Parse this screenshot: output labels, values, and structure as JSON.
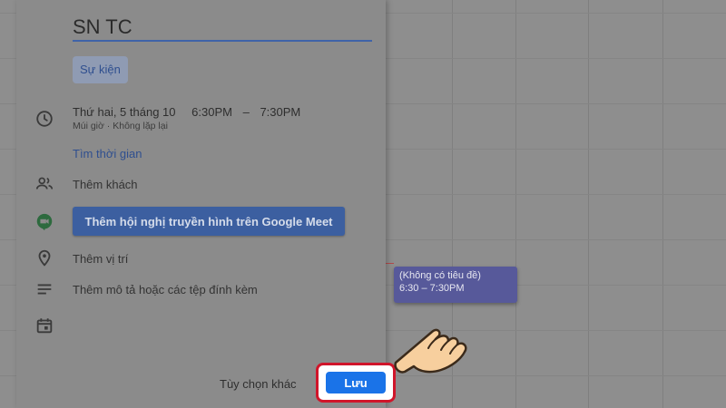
{
  "dialog": {
    "title_value": "SN TC",
    "tab_event": "Sự kiện",
    "date": "Thứ hai, 5 tháng 10",
    "start_time": "6:30PM",
    "separator": "–",
    "end_time": "7:30PM",
    "timezone_repeat": "Múi giờ · Không lặp lại",
    "find_time": "Tìm thời gian",
    "add_guests": "Thêm khách",
    "add_meet": "Thêm hội nghị truyền hình trên Google Meet",
    "add_location": "Thêm vị trí",
    "add_description": "Thêm mô tả hoặc các tệp đính kèm",
    "more_options": "Tùy chọn khác",
    "save": "Lưu"
  },
  "calendar_event": {
    "title": "(Không có tiêu đề)",
    "time": "6:30 – 7:30PM"
  },
  "icons": [
    "clock-icon",
    "people-icon",
    "google-meet-icon",
    "location-pin-icon",
    "description-icon",
    "calendar-icon",
    "pointing-hand-icon"
  ],
  "colors": {
    "accent": "#1a73e8",
    "highlight": "#d0152a",
    "event_chip": "#57599a"
  }
}
